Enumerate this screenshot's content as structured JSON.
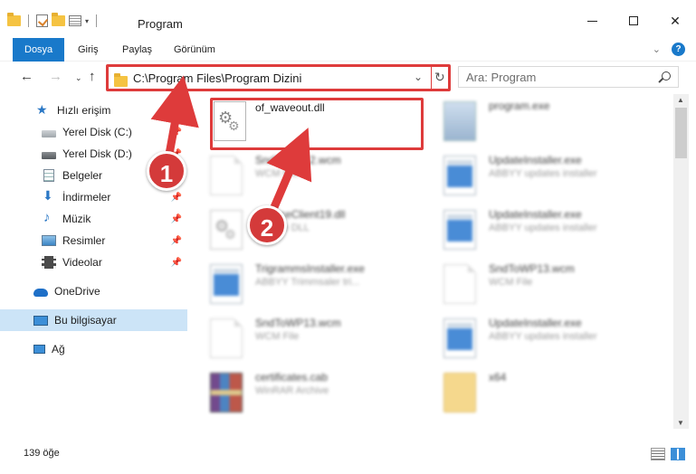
{
  "window": {
    "title": "Program"
  },
  "ribbon": {
    "tabs": [
      "Dosya",
      "Giriş",
      "Paylaş",
      "Görünüm"
    ]
  },
  "address": {
    "path": "C:\\Program Files\\Program Dizini"
  },
  "search": {
    "placeholder": "Ara: Program"
  },
  "sidebar": {
    "items": [
      {
        "label": "Hızlı erişim",
        "icon": "star-icon"
      },
      {
        "label": "Yerel Disk (C:)",
        "icon": "drive-icon"
      },
      {
        "label": "Yerel Disk (D:)",
        "icon": "drive-icon"
      },
      {
        "label": "Belgeler",
        "icon": "documents-icon"
      },
      {
        "label": "İndirmeler",
        "icon": "download-icon"
      },
      {
        "label": "Müzik",
        "icon": "music-icon"
      },
      {
        "label": "Resimler",
        "icon": "pictures-icon"
      },
      {
        "label": "Videolar",
        "icon": "video-icon"
      },
      {
        "label": "OneDrive",
        "icon": "cloud-icon"
      },
      {
        "label": "Bu bilgisayar",
        "icon": "computer-icon"
      },
      {
        "label": "Ağ",
        "icon": "network-icon"
      }
    ]
  },
  "files": [
    {
      "name": "of_waveout.dll",
      "desc": "",
      "icon": "dll-icon",
      "blurred": false
    },
    {
      "name": "program.exe",
      "desc": "",
      "icon": "exe-icon",
      "blurred": true
    },
    {
      "name": "SndToWP12.wcm",
      "desc": "WCM File",
      "icon": "document-icon",
      "blurred": true
    },
    {
      "name": "UpdateInstaller.exe",
      "desc": "ABBYY updates installer",
      "icon": "window-icon",
      "blurred": true
    },
    {
      "name": "ServiceClient19.dll",
      "desc": "Service DLL",
      "icon": "dll-icon",
      "blurred": true
    },
    {
      "name": "UpdateInstaller.exe",
      "desc": "ABBYY updates installer",
      "icon": "window-icon",
      "blurred": true
    },
    {
      "name": "TrigrammsInstaller.exe",
      "desc": "ABBYY Trimmsaler tri...",
      "icon": "window-icon",
      "blurred": true
    },
    {
      "name": "SndToWP13.wcm",
      "desc": "WCM File",
      "icon": "document-icon",
      "blurred": true
    },
    {
      "name": "SndToWP13.wcm",
      "desc": "WCM File",
      "icon": "document-icon",
      "blurred": true
    },
    {
      "name": "UpdateInstaller.exe",
      "desc": "ABBYY updates installer",
      "icon": "window-icon",
      "blurred": true
    },
    {
      "name": "certificates.cab",
      "desc": "WinRAR Archive",
      "icon": "archive-icon",
      "blurred": true
    },
    {
      "name": "x64",
      "desc": "",
      "icon": "folder-icon",
      "blurred": true
    }
  ],
  "status": {
    "count": "139 öğe"
  },
  "annotations": {
    "step1": "1",
    "step2": "2",
    "color": "#de3b3b"
  }
}
